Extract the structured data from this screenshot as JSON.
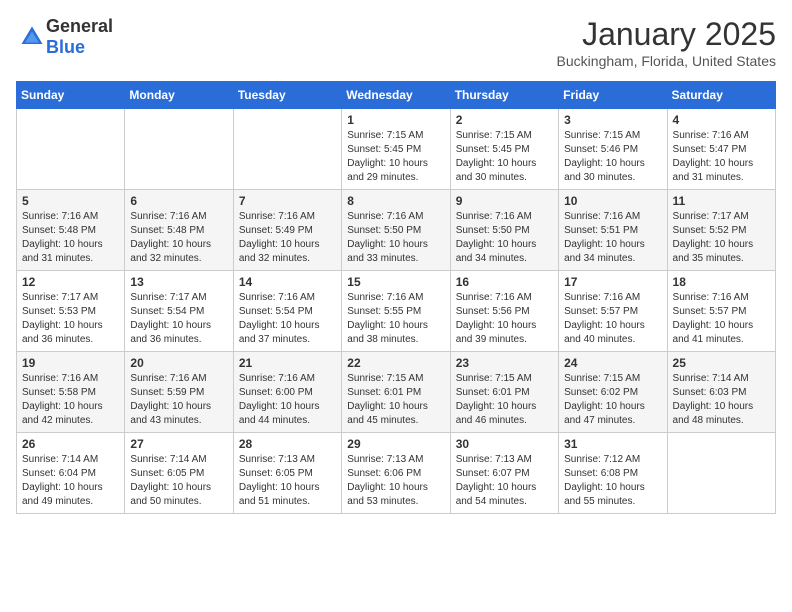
{
  "header": {
    "logo_general": "General",
    "logo_blue": "Blue",
    "month": "January 2025",
    "location": "Buckingham, Florida, United States"
  },
  "weekdays": [
    "Sunday",
    "Monday",
    "Tuesday",
    "Wednesday",
    "Thursday",
    "Friday",
    "Saturday"
  ],
  "weeks": [
    [
      {
        "day": "",
        "info": ""
      },
      {
        "day": "",
        "info": ""
      },
      {
        "day": "",
        "info": ""
      },
      {
        "day": "1",
        "info": "Sunrise: 7:15 AM\nSunset: 5:45 PM\nDaylight: 10 hours\nand 29 minutes."
      },
      {
        "day": "2",
        "info": "Sunrise: 7:15 AM\nSunset: 5:45 PM\nDaylight: 10 hours\nand 30 minutes."
      },
      {
        "day": "3",
        "info": "Sunrise: 7:15 AM\nSunset: 5:46 PM\nDaylight: 10 hours\nand 30 minutes."
      },
      {
        "day": "4",
        "info": "Sunrise: 7:16 AM\nSunset: 5:47 PM\nDaylight: 10 hours\nand 31 minutes."
      }
    ],
    [
      {
        "day": "5",
        "info": "Sunrise: 7:16 AM\nSunset: 5:48 PM\nDaylight: 10 hours\nand 31 minutes."
      },
      {
        "day": "6",
        "info": "Sunrise: 7:16 AM\nSunset: 5:48 PM\nDaylight: 10 hours\nand 32 minutes."
      },
      {
        "day": "7",
        "info": "Sunrise: 7:16 AM\nSunset: 5:49 PM\nDaylight: 10 hours\nand 32 minutes."
      },
      {
        "day": "8",
        "info": "Sunrise: 7:16 AM\nSunset: 5:50 PM\nDaylight: 10 hours\nand 33 minutes."
      },
      {
        "day": "9",
        "info": "Sunrise: 7:16 AM\nSunset: 5:50 PM\nDaylight: 10 hours\nand 34 minutes."
      },
      {
        "day": "10",
        "info": "Sunrise: 7:16 AM\nSunset: 5:51 PM\nDaylight: 10 hours\nand 34 minutes."
      },
      {
        "day": "11",
        "info": "Sunrise: 7:17 AM\nSunset: 5:52 PM\nDaylight: 10 hours\nand 35 minutes."
      }
    ],
    [
      {
        "day": "12",
        "info": "Sunrise: 7:17 AM\nSunset: 5:53 PM\nDaylight: 10 hours\nand 36 minutes."
      },
      {
        "day": "13",
        "info": "Sunrise: 7:17 AM\nSunset: 5:54 PM\nDaylight: 10 hours\nand 36 minutes."
      },
      {
        "day": "14",
        "info": "Sunrise: 7:16 AM\nSunset: 5:54 PM\nDaylight: 10 hours\nand 37 minutes."
      },
      {
        "day": "15",
        "info": "Sunrise: 7:16 AM\nSunset: 5:55 PM\nDaylight: 10 hours\nand 38 minutes."
      },
      {
        "day": "16",
        "info": "Sunrise: 7:16 AM\nSunset: 5:56 PM\nDaylight: 10 hours\nand 39 minutes."
      },
      {
        "day": "17",
        "info": "Sunrise: 7:16 AM\nSunset: 5:57 PM\nDaylight: 10 hours\nand 40 minutes."
      },
      {
        "day": "18",
        "info": "Sunrise: 7:16 AM\nSunset: 5:57 PM\nDaylight: 10 hours\nand 41 minutes."
      }
    ],
    [
      {
        "day": "19",
        "info": "Sunrise: 7:16 AM\nSunset: 5:58 PM\nDaylight: 10 hours\nand 42 minutes."
      },
      {
        "day": "20",
        "info": "Sunrise: 7:16 AM\nSunset: 5:59 PM\nDaylight: 10 hours\nand 43 minutes."
      },
      {
        "day": "21",
        "info": "Sunrise: 7:16 AM\nSunset: 6:00 PM\nDaylight: 10 hours\nand 44 minutes."
      },
      {
        "day": "22",
        "info": "Sunrise: 7:15 AM\nSunset: 6:01 PM\nDaylight: 10 hours\nand 45 minutes."
      },
      {
        "day": "23",
        "info": "Sunrise: 7:15 AM\nSunset: 6:01 PM\nDaylight: 10 hours\nand 46 minutes."
      },
      {
        "day": "24",
        "info": "Sunrise: 7:15 AM\nSunset: 6:02 PM\nDaylight: 10 hours\nand 47 minutes."
      },
      {
        "day": "25",
        "info": "Sunrise: 7:14 AM\nSunset: 6:03 PM\nDaylight: 10 hours\nand 48 minutes."
      }
    ],
    [
      {
        "day": "26",
        "info": "Sunrise: 7:14 AM\nSunset: 6:04 PM\nDaylight: 10 hours\nand 49 minutes."
      },
      {
        "day": "27",
        "info": "Sunrise: 7:14 AM\nSunset: 6:05 PM\nDaylight: 10 hours\nand 50 minutes."
      },
      {
        "day": "28",
        "info": "Sunrise: 7:13 AM\nSunset: 6:05 PM\nDaylight: 10 hours\nand 51 minutes."
      },
      {
        "day": "29",
        "info": "Sunrise: 7:13 AM\nSunset: 6:06 PM\nDaylight: 10 hours\nand 53 minutes."
      },
      {
        "day": "30",
        "info": "Sunrise: 7:13 AM\nSunset: 6:07 PM\nDaylight: 10 hours\nand 54 minutes."
      },
      {
        "day": "31",
        "info": "Sunrise: 7:12 AM\nSunset: 6:08 PM\nDaylight: 10 hours\nand 55 minutes."
      },
      {
        "day": "",
        "info": ""
      }
    ]
  ]
}
